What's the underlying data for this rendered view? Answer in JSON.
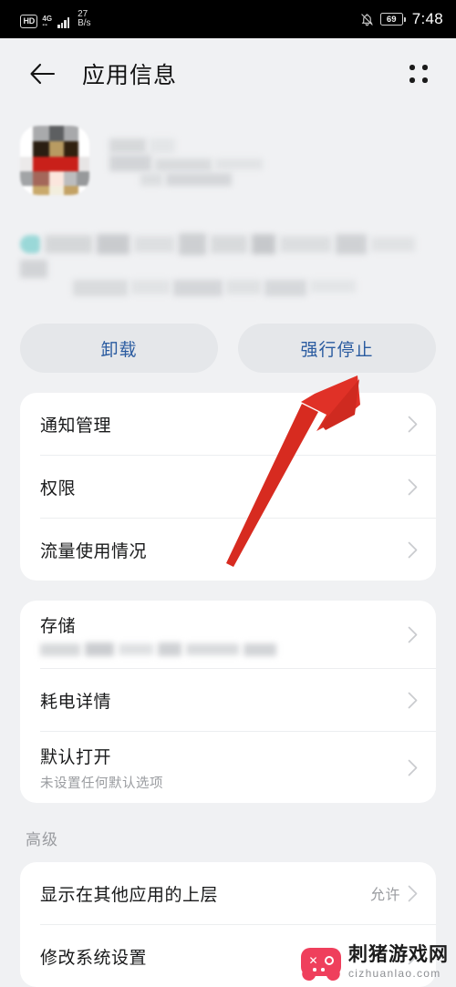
{
  "statusbar": {
    "hd_label": "HD",
    "network_label": "4G",
    "data_rate_value": "27",
    "data_rate_unit": "B/s",
    "mute_icon": "bell-muted-icon",
    "battery_level": "69",
    "clock": "7:48"
  },
  "appbar": {
    "back_icon": "back-arrow-icon",
    "title": "应用信息",
    "menu_icon": "grid-dots-icon"
  },
  "app": {
    "icon": "app-icon-censored",
    "name_censored": true,
    "description_censored": true
  },
  "actions": {
    "uninstall_label": "卸载",
    "force_stop_label": "强行停止"
  },
  "cards": [
    {
      "rows": [
        {
          "label": "通知管理",
          "sub": "",
          "value": "",
          "chevron": true
        },
        {
          "label": "权限",
          "sub": "",
          "value": "",
          "chevron": true
        },
        {
          "label": "流量使用情况",
          "sub": "",
          "value": "",
          "chevron": true
        }
      ]
    },
    {
      "rows": [
        {
          "label": "存储",
          "sub": "",
          "sub_censored": true,
          "value": "",
          "chevron": true
        },
        {
          "label": "耗电详情",
          "sub": "",
          "value": "",
          "chevron": true
        },
        {
          "label": "默认打开",
          "sub": "未设置任何默认选项",
          "value": "",
          "chevron": true
        }
      ]
    }
  ],
  "advanced": {
    "section_title": "高级",
    "rows": [
      {
        "label": "显示在其他应用的上层",
        "value": "允许",
        "chevron": true
      },
      {
        "label": "修改系统设置",
        "value": "",
        "chevron": true
      }
    ]
  },
  "annotation": {
    "arrow_color": "#e03127",
    "arrow_target": "强行停止"
  },
  "watermark": {
    "icon": "gamepad-icon",
    "title": "刺猪游戏网",
    "url": "cizhuanlao.com",
    "color": "#ef3f5c"
  }
}
